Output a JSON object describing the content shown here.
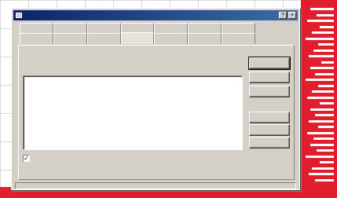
{
  "window": {
    "title": "",
    "caption_help": "?",
    "caption_close": "×"
  },
  "tabs_row1": [
    "",
    "",
    "",
    "",
    "",
    "",
    ""
  ],
  "tabs_row2": [
    "",
    "",
    "",
    "",
    "",
    "",
    ""
  ],
  "active_tab": {
    "row": 2,
    "index": 3
  },
  "panel": {
    "description": "",
    "checkbox_label": "",
    "checkbox_checked": true,
    "checkbox_mark": "✓"
  },
  "buttons": {
    "top": [
      "",
      "",
      ""
    ],
    "bottom": [
      "",
      "",
      ""
    ]
  },
  "status_text": "",
  "colors": {
    "window_face": "#d4d0c8",
    "title_bar": "#0a246a",
    "accent_red": "#e01e2e"
  }
}
